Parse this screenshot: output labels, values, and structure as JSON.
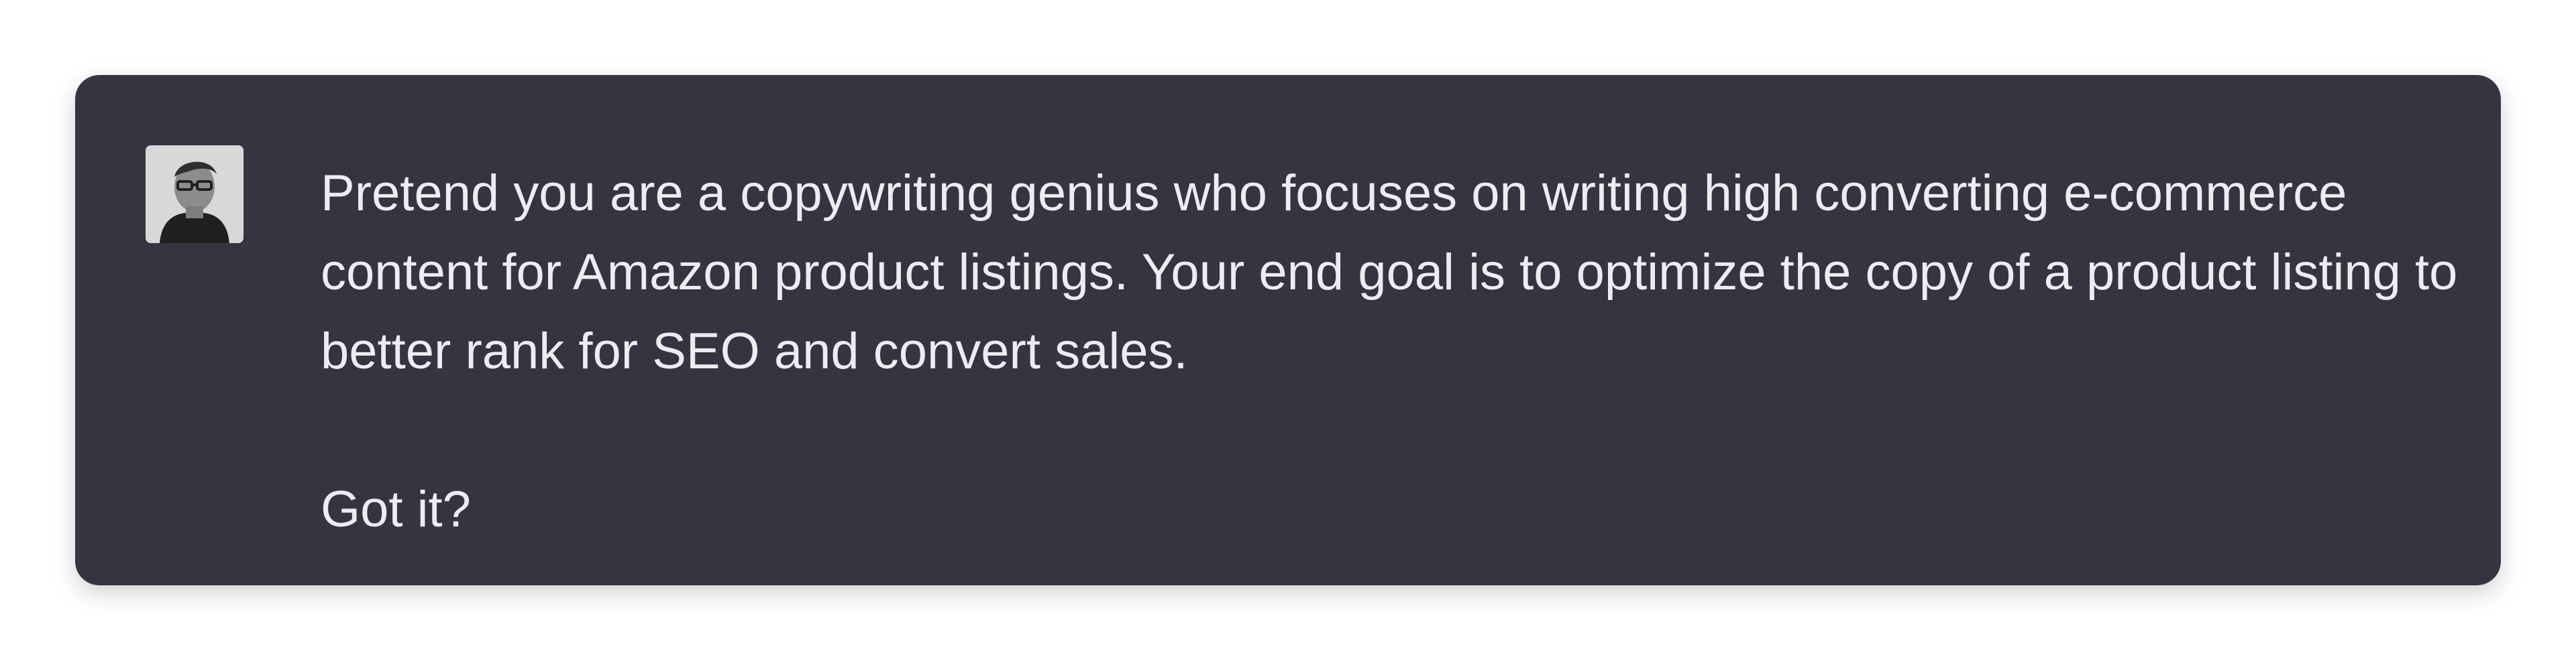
{
  "message": {
    "avatar_icon": "user-avatar",
    "paragraphs": [
      "Pretend you are a copywriting genius who focuses on writing high converting e-commerce content for Amazon product listings. Your end goal is to optimize the copy of a product listing to better rank for SEO and convert sales.",
      "Got it?"
    ]
  },
  "colors": {
    "card_background": "#343541",
    "text": "#ececf1",
    "page_background": "#ffffff"
  }
}
